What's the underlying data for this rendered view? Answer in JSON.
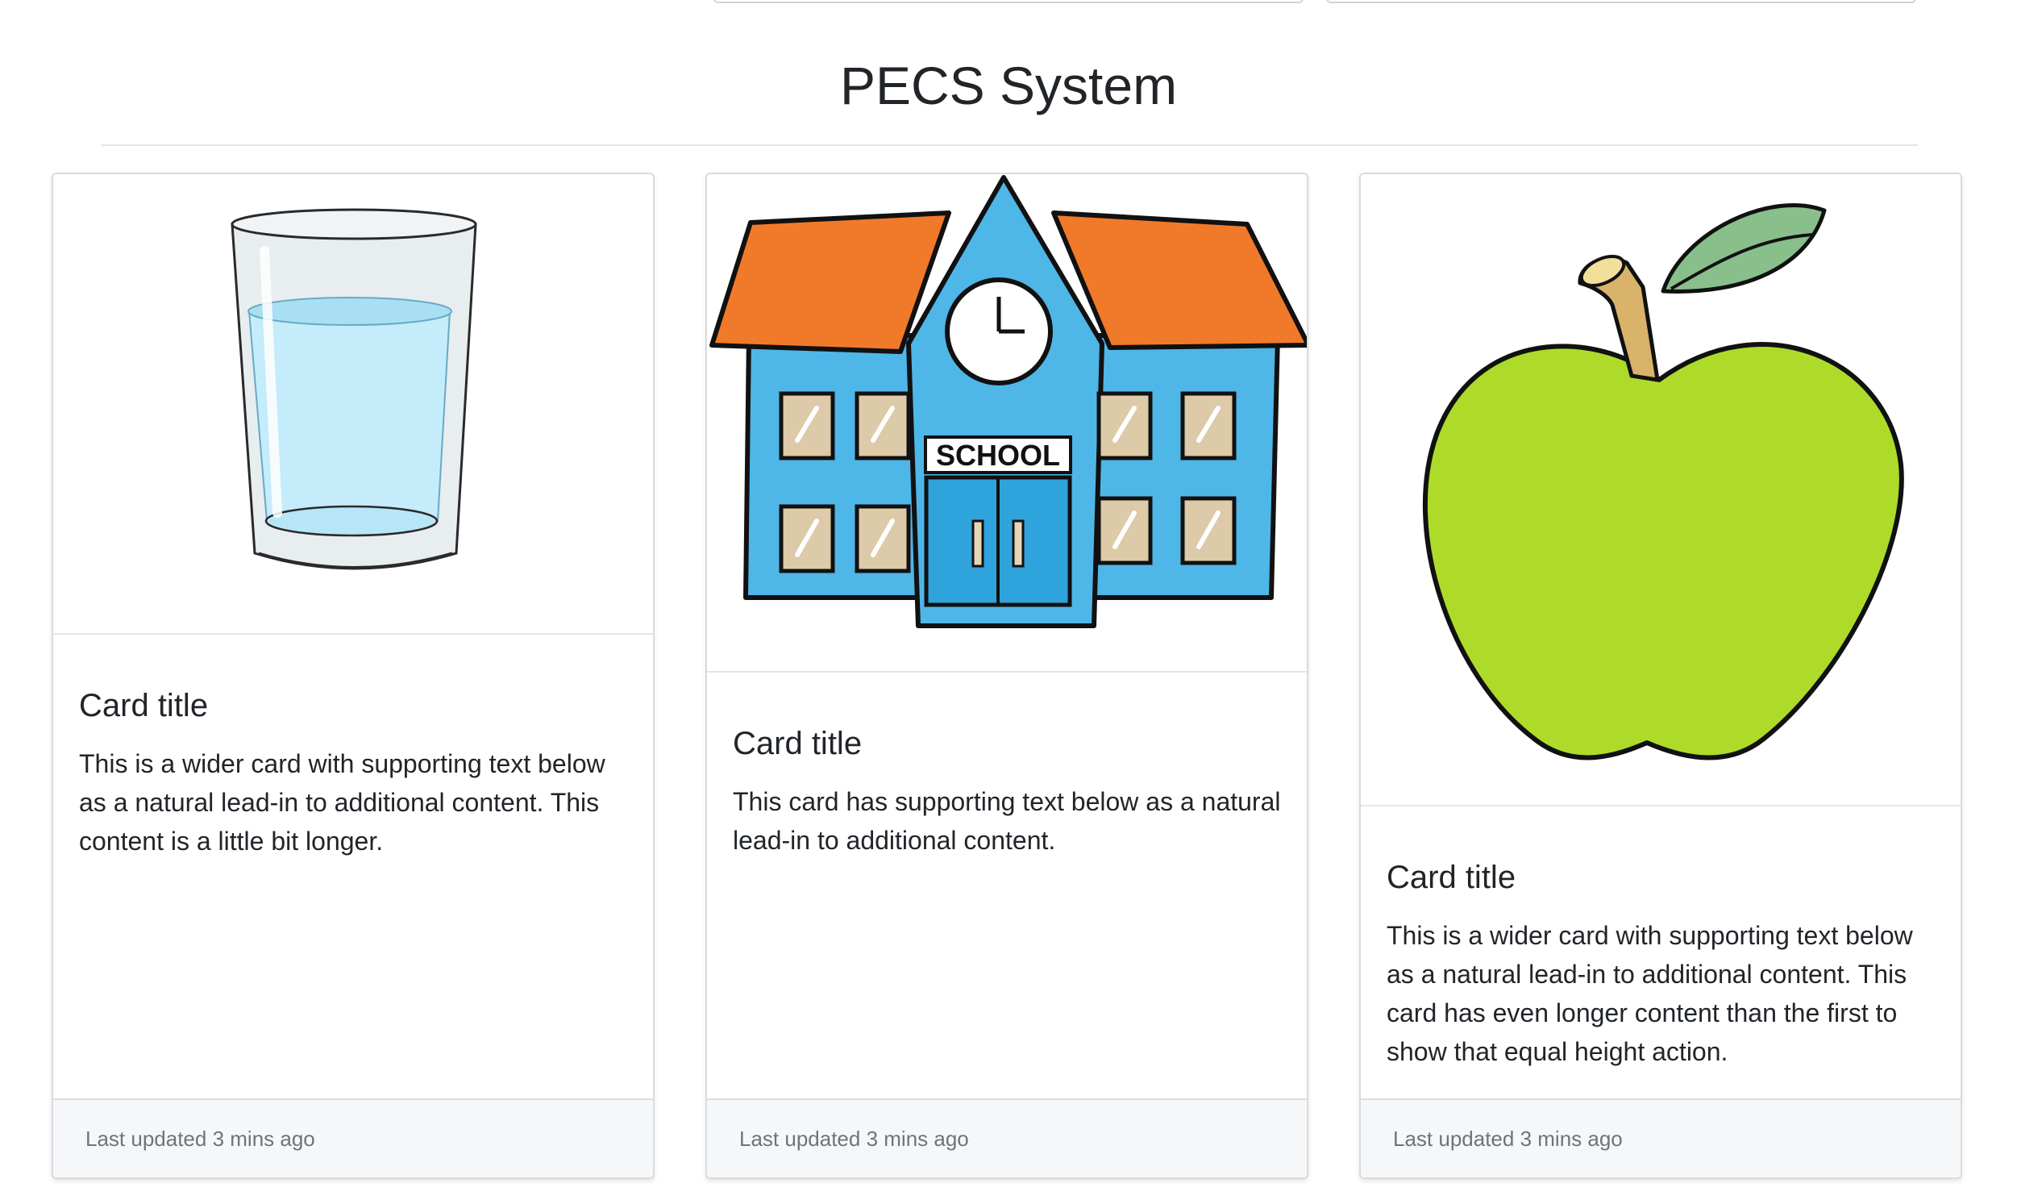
{
  "page": {
    "title": "PECS System"
  },
  "cards": [
    {
      "image": "glass-of-water-image",
      "title": "Card title",
      "text": "This is a wider card with supporting text below as a natural lead-in to additional content. This content is a little bit longer.",
      "footer": "Last updated 3 mins ago"
    },
    {
      "image": "school-building-image",
      "title": "Card title",
      "text": "This card has supporting text below as a natural lead-in to additional content.",
      "footer": "Last updated 3 mins ago",
      "sign_text": "SCHOOL"
    },
    {
      "image": "green-apple-image",
      "title": "Card title",
      "text": "This is a wider card with supporting text below as a natural lead-in to additional content. This card has even longer content than the first to show that equal height action.",
      "footer": "Last updated 3 mins ago"
    }
  ],
  "colors": {
    "roof": "#f07a2a",
    "building": "#4fb6e8",
    "apple": "#aedb2a",
    "leaf": "#88bf8a",
    "water": "#c4ecfa",
    "footer_bg": "#f6f7f8"
  }
}
